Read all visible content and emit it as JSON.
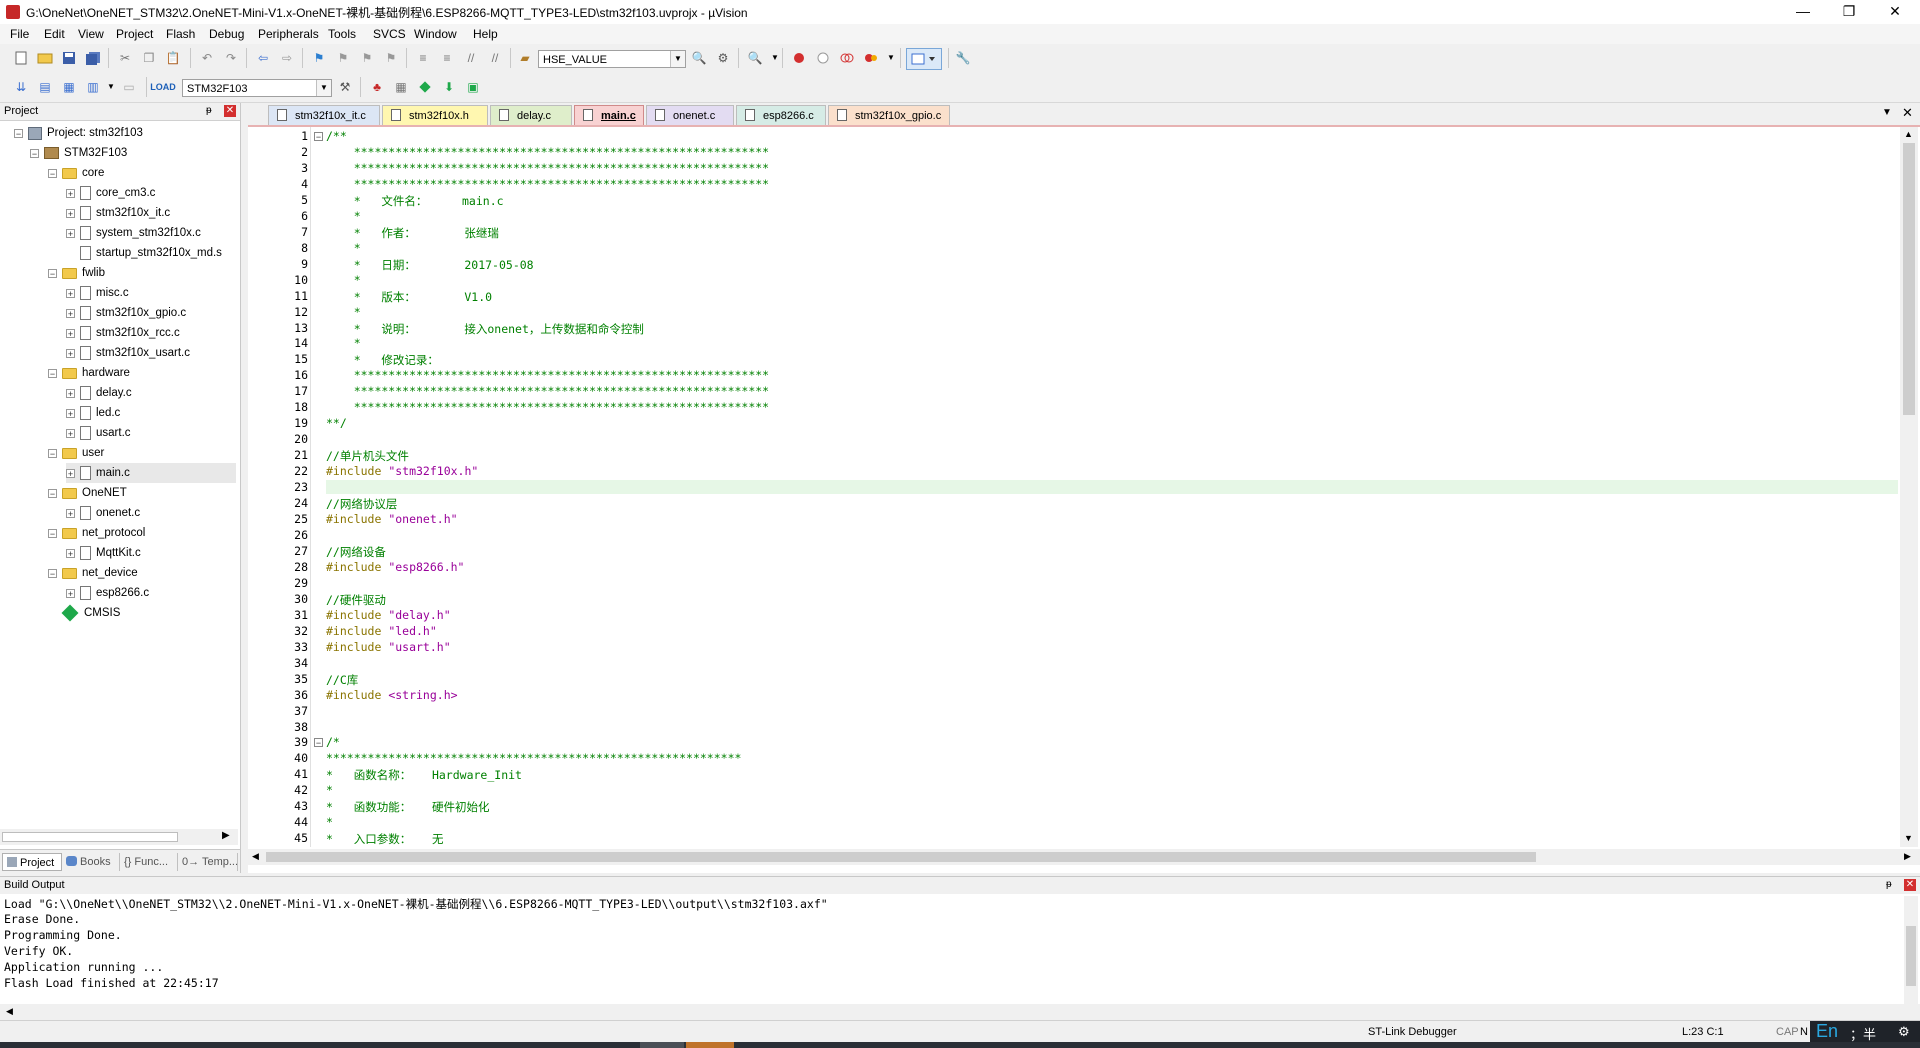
{
  "window": {
    "title": "G:\\OneNet\\OneNET_STM32\\2.OneNET-Mini-V1.x-OneNET-裸机-基础例程\\6.ESP8266-MQTT_TYPE3-LED\\stm32f103.uvprojx - µVision",
    "minimize": "—",
    "maximize": "❐",
    "close": "✕"
  },
  "menu": [
    "File",
    "Edit",
    "View",
    "Project",
    "Flash",
    "Debug",
    "Peripherals",
    "Tools",
    "SVCS",
    "Window",
    "Help"
  ],
  "toolbar": {
    "find_combo_value": "HSE_VALUE",
    "target_combo_value": "STM32F103"
  },
  "project_panel": {
    "title": "Project",
    "pin": "ᵽ",
    "close": "✕",
    "tree": [
      {
        "label": "Project: stm32f103",
        "type": "project",
        "level": 0,
        "exp": "−"
      },
      {
        "label": "STM32F103",
        "type": "target",
        "level": 1,
        "exp": "−"
      },
      {
        "label": "core",
        "type": "folder",
        "level": 2,
        "exp": "−"
      },
      {
        "label": "core_cm3.c",
        "type": "file",
        "level": 3,
        "exp": "+"
      },
      {
        "label": "stm32f10x_it.c",
        "type": "file",
        "level": 3,
        "exp": "+"
      },
      {
        "label": "system_stm32f10x.c",
        "type": "file",
        "level": 3,
        "exp": "+"
      },
      {
        "label": "startup_stm32f10x_md.s",
        "type": "file",
        "level": 3,
        "exp": ""
      },
      {
        "label": "fwlib",
        "type": "folder",
        "level": 2,
        "exp": "−"
      },
      {
        "label": "misc.c",
        "type": "file",
        "level": 3,
        "exp": "+"
      },
      {
        "label": "stm32f10x_gpio.c",
        "type": "file",
        "level": 3,
        "exp": "+"
      },
      {
        "label": "stm32f10x_rcc.c",
        "type": "file",
        "level": 3,
        "exp": "+"
      },
      {
        "label": "stm32f10x_usart.c",
        "type": "file",
        "level": 3,
        "exp": "+"
      },
      {
        "label": "hardware",
        "type": "folder",
        "level": 2,
        "exp": "−"
      },
      {
        "label": "delay.c",
        "type": "file",
        "level": 3,
        "exp": "+"
      },
      {
        "label": "led.c",
        "type": "file",
        "level": 3,
        "exp": "+"
      },
      {
        "label": "usart.c",
        "type": "file",
        "level": 3,
        "exp": "+"
      },
      {
        "label": "user",
        "type": "folder",
        "level": 2,
        "exp": "−"
      },
      {
        "label": "main.c",
        "type": "file",
        "level": 3,
        "exp": "+",
        "selected": true
      },
      {
        "label": "OneNET",
        "type": "folder",
        "level": 2,
        "exp": "−"
      },
      {
        "label": "onenet.c",
        "type": "file",
        "level": 3,
        "exp": "+"
      },
      {
        "label": "net_protocol",
        "type": "folder",
        "level": 2,
        "exp": "−"
      },
      {
        "label": "MqttKit.c",
        "type": "file",
        "level": 3,
        "exp": "+"
      },
      {
        "label": "net_device",
        "type": "folder",
        "level": 2,
        "exp": "−"
      },
      {
        "label": "esp8266.c",
        "type": "file",
        "level": 3,
        "exp": "+"
      },
      {
        "label": "CMSIS",
        "type": "cmsis",
        "level": 2,
        "exp": ""
      }
    ],
    "tabs": [
      "Project",
      "Books",
      "{} Func...",
      "0→ Temp..."
    ]
  },
  "editor": {
    "tabs": [
      {
        "label": "stm32f10x_it.c",
        "color": "#dce6f5"
      },
      {
        "label": "stm32f10x.h",
        "color": "#fff7b0"
      },
      {
        "label": "delay.c",
        "color": "#dfeecb"
      },
      {
        "label": "main.c",
        "color": "#f8d2d2",
        "active": true
      },
      {
        "label": "onenet.c",
        "color": "#e3dcf2"
      },
      {
        "label": "esp8266.c",
        "color": "#d6ece6"
      },
      {
        "label": "stm32f10x_gpio.c",
        "color": "#fbe0cc"
      }
    ],
    "lines": [
      {
        "n": "1",
        "t": "/**",
        "fold": "−"
      },
      {
        "n": "2",
        "t": "    ************************************************************"
      },
      {
        "n": "3",
        "t": "    ************************************************************"
      },
      {
        "n": "4",
        "t": "    ************************************************************"
      },
      {
        "n": "5",
        "t": "    *   文件名：     main.c"
      },
      {
        "n": "6",
        "t": "    *"
      },
      {
        "n": "7",
        "t": "    *   作者：       张继瑞"
      },
      {
        "n": "8",
        "t": "    *"
      },
      {
        "n": "9",
        "t": "    *   日期：       2017-05-08"
      },
      {
        "n": "10",
        "t": "    *"
      },
      {
        "n": "11",
        "t": "    *   版本：       V1.0"
      },
      {
        "n": "12",
        "t": "    *"
      },
      {
        "n": "13",
        "t": "    *   说明：       接入onenet，上传数据和命令控制"
      },
      {
        "n": "14",
        "t": "    *"
      },
      {
        "n": "15",
        "t": "    *   修改记录："
      },
      {
        "n": "16",
        "t": "    ************************************************************"
      },
      {
        "n": "17",
        "t": "    ************************************************************"
      },
      {
        "n": "18",
        "t": "    ************************************************************"
      },
      {
        "n": "19",
        "t": "**/"
      },
      {
        "n": "20",
        "t": ""
      },
      {
        "n": "21",
        "t": "//单片机头文件"
      },
      {
        "n": "22",
        "t": "#include ",
        "s": "\"stm32f10x.h\"",
        "pp": true
      },
      {
        "n": "23",
        "t": "",
        "hl": true
      },
      {
        "n": "24",
        "t": "//网络协议层"
      },
      {
        "n": "25",
        "t": "#include ",
        "s": "\"onenet.h\"",
        "pp": true
      },
      {
        "n": "26",
        "t": ""
      },
      {
        "n": "27",
        "t": "//网络设备"
      },
      {
        "n": "28",
        "t": "#include ",
        "s": "\"esp8266.h\"",
        "pp": true
      },
      {
        "n": "29",
        "t": ""
      },
      {
        "n": "30",
        "t": "//硬件驱动"
      },
      {
        "n": "31",
        "t": "#include ",
        "s": "\"delay.h\"",
        "pp": true
      },
      {
        "n": "32",
        "t": "#include ",
        "s": "\"led.h\"",
        "pp": true
      },
      {
        "n": "33",
        "t": "#include ",
        "s": "\"usart.h\"",
        "pp": true
      },
      {
        "n": "34",
        "t": ""
      },
      {
        "n": "35",
        "t": "//C库"
      },
      {
        "n": "36",
        "t": "#include ",
        "s": "<string.h>",
        "pp": true
      },
      {
        "n": "37",
        "t": ""
      },
      {
        "n": "38",
        "t": ""
      },
      {
        "n": "39",
        "t": "/*",
        "fold": "−"
      },
      {
        "n": "40",
        "t": "************************************************************"
      },
      {
        "n": "41",
        "t": "*   函数名称：   Hardware_Init"
      },
      {
        "n": "42",
        "t": "*"
      },
      {
        "n": "43",
        "t": "*   函数功能：   硬件初始化"
      },
      {
        "n": "44",
        "t": "*"
      },
      {
        "n": "45",
        "t": "*   入口参数：   无"
      }
    ]
  },
  "build_output": {
    "title": "Build Output",
    "lines": [
      "Load \"G:\\\\OneNet\\\\OneNET_STM32\\\\2.OneNET-Mini-V1.x-OneNET-裸机-基础例程\\\\6.ESP8266-MQTT_TYPE3-LED\\\\output\\\\stm32f103.axf\"",
      "Erase Done.",
      "Programming Done.",
      "Verify OK.",
      "Application running ...",
      "Flash Load finished at 22:45:17"
    ]
  },
  "status": {
    "debugger": "ST-Link Debugger",
    "position": "L:23 C:1",
    "caps": "CAP",
    "num": "N",
    "ime": "En",
    "ime_extra": "；半"
  }
}
